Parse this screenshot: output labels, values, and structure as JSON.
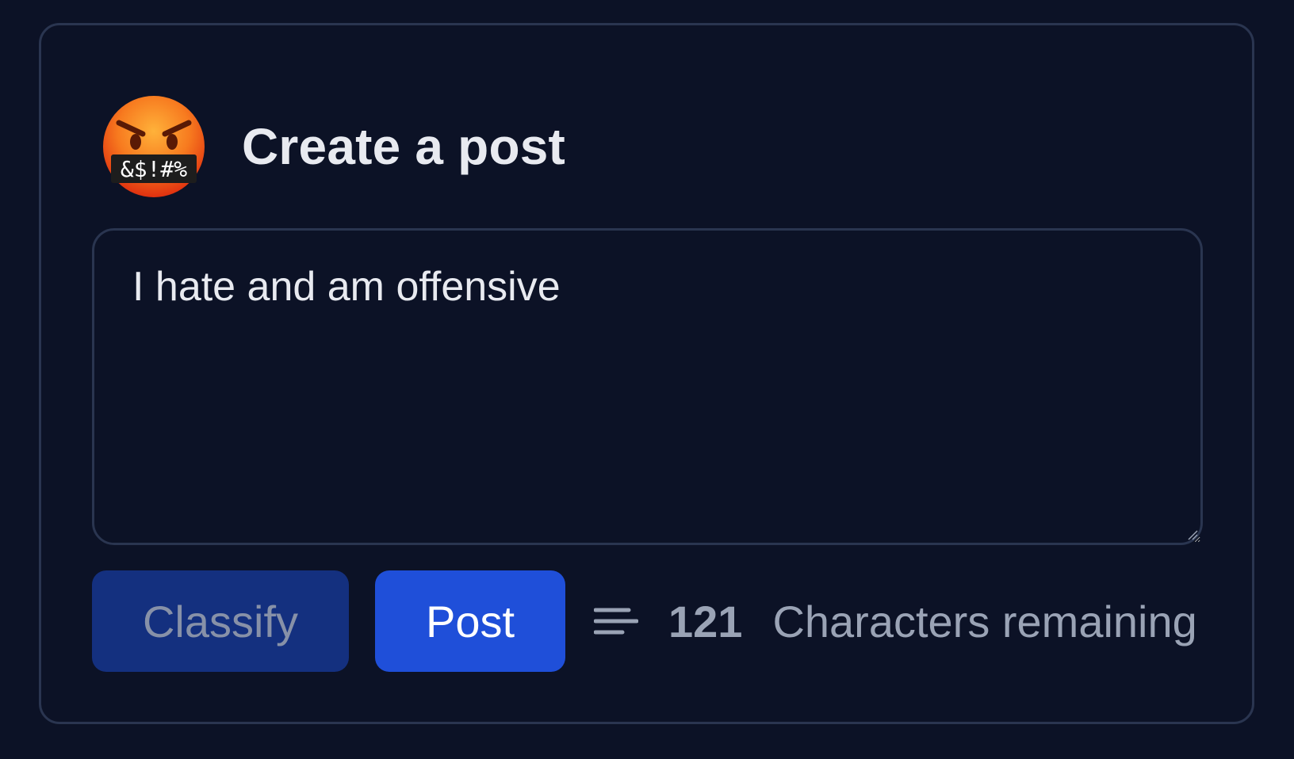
{
  "card": {
    "title": "Create a post",
    "avatar_icon": "angry-face-with-symbols-icon",
    "avatar_symbols": "&$!#%"
  },
  "composer": {
    "value": "I hate and am offensive",
    "placeholder": ""
  },
  "actions": {
    "classify_label": "Classify",
    "post_label": "Post"
  },
  "counter": {
    "icon": "text-lines-icon",
    "remaining": "121",
    "label": "Characters remaining"
  },
  "colors": {
    "background": "#0c1226",
    "border": "#2a3550",
    "classify_button": "#14307f",
    "post_button": "#1f4fd9",
    "muted_text": "#9aa3b5"
  }
}
